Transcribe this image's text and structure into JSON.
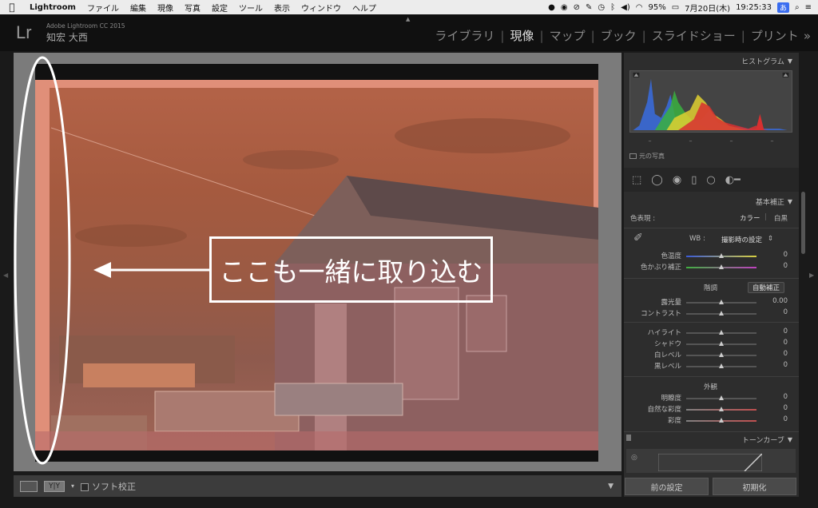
{
  "menubar": {
    "items": [
      "Lightroom",
      "ファイル",
      "編集",
      "現像",
      "写真",
      "設定",
      "ツール",
      "表示",
      "ウィンドウ",
      "ヘルプ"
    ],
    "battery": "95%",
    "date": "7月20日(木)",
    "time": "19:25:33",
    "ime": "あ"
  },
  "header": {
    "logo": "Lr",
    "product": "Adobe Lightroom CC 2015",
    "identity": "知宏 大西",
    "modules": [
      "ライブラリ",
      "現像",
      "マップ",
      "ブック",
      "スライドショー",
      "プリント"
    ],
    "active_module": "現像"
  },
  "annotation": {
    "text": "ここも一緒に取り込む",
    "color": "#ffffff"
  },
  "toolbar": {
    "yy_label": "Y|Y",
    "soft_proof": "ソフト校正"
  },
  "right_panel": {
    "histogram_title": "ヒストグラム",
    "original_photo": "元の写真",
    "basic_title": "基本補正",
    "treatment_label": "色表現 :",
    "treatment_color": "カラー",
    "treatment_bw": "白黒",
    "wb_label": "WB :",
    "wb_value": "撮影時の設定",
    "tone_label": "階調",
    "auto_label": "自動補正",
    "presence_label": "外観",
    "tone_curve_title": "トーンカーブ",
    "sliders": [
      {
        "label": "色温度",
        "value": "0"
      },
      {
        "label": "色かぶり補正",
        "value": "0"
      },
      {
        "label": "露光量",
        "value": "0.00"
      },
      {
        "label": "コントラスト",
        "value": "0"
      },
      {
        "label": "ハイライト",
        "value": "0"
      },
      {
        "label": "シャドウ",
        "value": "0"
      },
      {
        "label": "白レベル",
        "value": "0"
      },
      {
        "label": "黒レベル",
        "value": "0"
      },
      {
        "label": "明瞭度",
        "value": "0"
      },
      {
        "label": "自然な彩度",
        "value": "0"
      },
      {
        "label": "彩度",
        "value": "0"
      }
    ],
    "btn_previous": "前の設定",
    "btn_reset": "初期化"
  },
  "colors": {
    "photo_tint": "#b46348",
    "frame_bg": "#7b7b7b",
    "accent_ime": "#3a6df0"
  }
}
